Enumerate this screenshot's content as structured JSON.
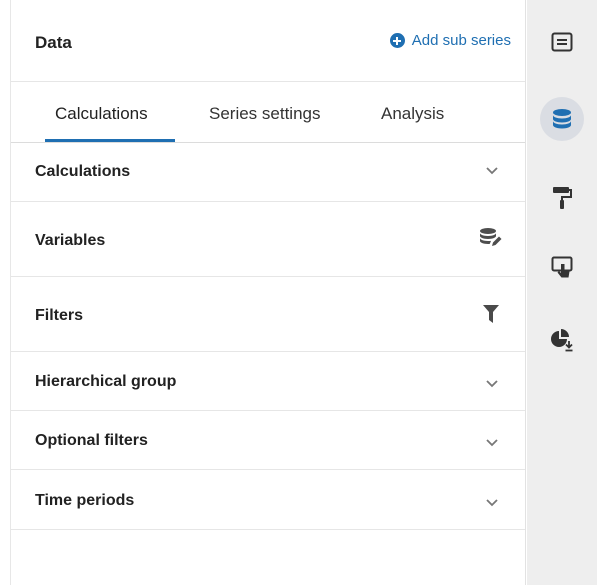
{
  "panel": {
    "title": "Data",
    "add_sub_series_label": "Add sub series"
  },
  "tabs": [
    {
      "label": "Calculations",
      "active": true
    },
    {
      "label": "Series settings",
      "active": false
    },
    {
      "label": "Analysis",
      "active": false
    }
  ],
  "sections": [
    {
      "label": "Calculations",
      "icon": "chevron-down-icon"
    },
    {
      "label": "Variables",
      "icon": "database-edit-icon"
    },
    {
      "label": "Filters",
      "icon": "filter-icon"
    },
    {
      "label": "Hierarchical group",
      "icon": "chevron-down-icon"
    },
    {
      "label": "Optional filters",
      "icon": "chevron-down-icon"
    },
    {
      "label": "Time periods",
      "icon": "chevron-down-icon"
    }
  ],
  "rail": [
    {
      "icon": "list-card-icon",
      "active": false
    },
    {
      "icon": "database-icon",
      "active": true
    },
    {
      "icon": "paint-roller-icon",
      "active": false
    },
    {
      "icon": "touch-screen-icon",
      "active": false
    },
    {
      "icon": "pie-chart-download-icon",
      "active": false
    }
  ],
  "colors": {
    "accent": "#1f6fb2",
    "rail_background": "#eeeeee",
    "rail_active": "#dadde3",
    "icon_dark": "#333333"
  }
}
